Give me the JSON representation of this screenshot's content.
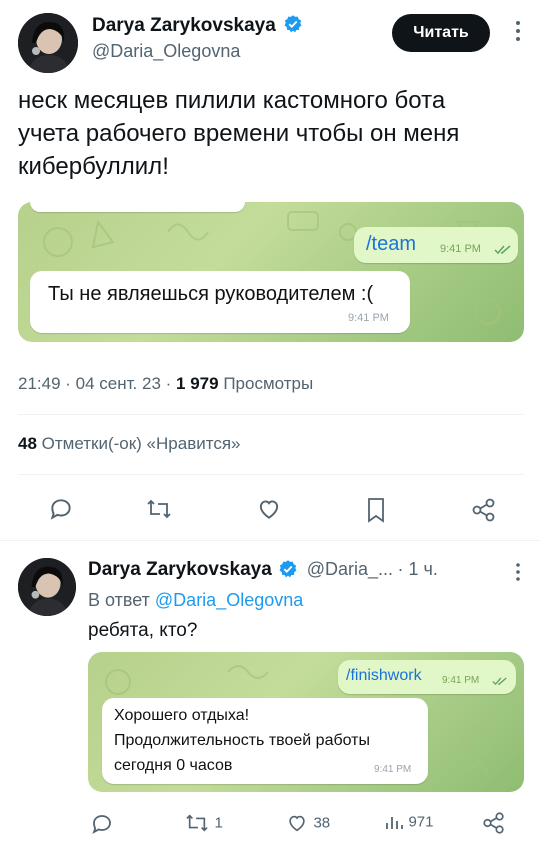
{
  "tweet": {
    "author_name": "Darya Zarykovskaya",
    "author_handle": "@Daria_Olegovna",
    "read_button": "Читать",
    "text": "неск месяцев пилили кастомного бота учета рабочего времени чтобы он меня кибербуллил!",
    "chat": {
      "outgoing_command": "/team",
      "outgoing_time": "9:41 PM",
      "incoming_text": "Ты не являешься руководителем :(",
      "incoming_time": "9:41 PM"
    },
    "meta": {
      "time": "21:49",
      "date": "04 сент. 23",
      "views_count": "1 979",
      "views_label": "Просмотры"
    },
    "likes": {
      "count": "48",
      "label": "Отметки(-ок) «Нравится»"
    }
  },
  "reply": {
    "author_name": "Darya Zarykovskaya",
    "author_handle": "@Daria_...",
    "time_ago": "1 ч.",
    "reply_to_prefix": "В ответ",
    "reply_to_handle": "@Daria_Olegovna",
    "text": "ребята, кто?",
    "chat": {
      "outgoing_command": "/finishwork",
      "outgoing_time": "9:41 PM",
      "incoming_line1": "Хорошего отдыха!",
      "incoming_line2": "Продолжительность твоей работы",
      "incoming_line3": "сегодня 0 часов",
      "incoming_time": "9:41 PM"
    },
    "actions": {
      "retweets": "1",
      "likes": "38",
      "views": "971"
    }
  },
  "colors": {
    "verified": "#1d9bf0",
    "chat_bg": "#b6d18c",
    "command_link": "#1a73d9"
  },
  "icons": [
    "verified-badge-icon",
    "comment-icon",
    "retweet-icon",
    "heart-icon",
    "bookmark-icon",
    "share-icon",
    "more-icon",
    "views-icon"
  ]
}
